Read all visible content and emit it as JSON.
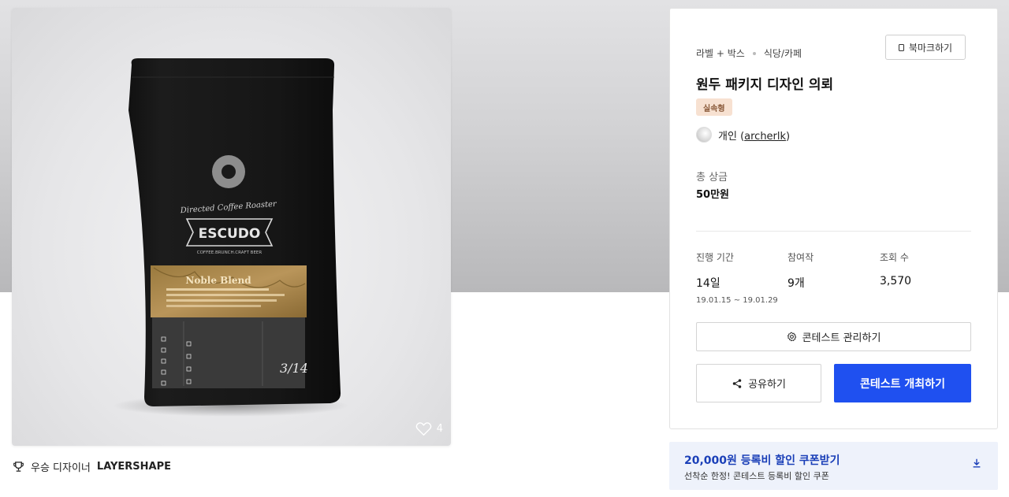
{
  "hero": {
    "like_count": "4",
    "product_art": {
      "script_text": "Directed Coffee Roaster",
      "brand": "ESCUDO",
      "tagline": "COFFEE.BRUNCH.CRAFT BEER",
      "blend": "Noble Blend",
      "date_mark": "3/14",
      "roasting_items": [
        "Guatemala",
        "Brazil",
        "Guatemala",
        "Ethiopia",
        "Kenya"
      ],
      "flavor_items": [
        "CARAMEL",
        "Milk Chocolate",
        "Complex Nutty",
        "Strong Body"
      ]
    }
  },
  "winner": {
    "prefix": "우승 디자이너",
    "name": "LAYERSHAPE"
  },
  "panel": {
    "category": "라벨 + 박스",
    "subcategory": "식당/카페",
    "bookmark_label": "북마크하기",
    "title": "원두 패키지 디자인 의뢰",
    "badge": "실속형",
    "owner_type": "개인",
    "owner_handle": "archerlk",
    "prize_label": "총 상금",
    "prize_value": "50만원",
    "stats": [
      {
        "label": "진행 기간",
        "value": "14일",
        "sub": "19.01.15 ~ 19.01.29"
      },
      {
        "label": "참여작",
        "value": "9개"
      },
      {
        "label": "조회 수",
        "value": "3,570"
      }
    ],
    "manage_label": "콘테스트 관리하기",
    "share_label": "공유하기",
    "host_label": "콘테스트 개최하기"
  },
  "coupon": {
    "title": "20,000원 등록비 할인 쿠폰받기",
    "subtitle": "선착순 한정! 콘테스트 등록비 할인 쿠폰"
  },
  "colors": {
    "primary": "#1f50f0",
    "badge_bg": "#f7e1d1",
    "coupon_bg": "#eef2fb",
    "coupon_text": "#1a3fb8"
  }
}
